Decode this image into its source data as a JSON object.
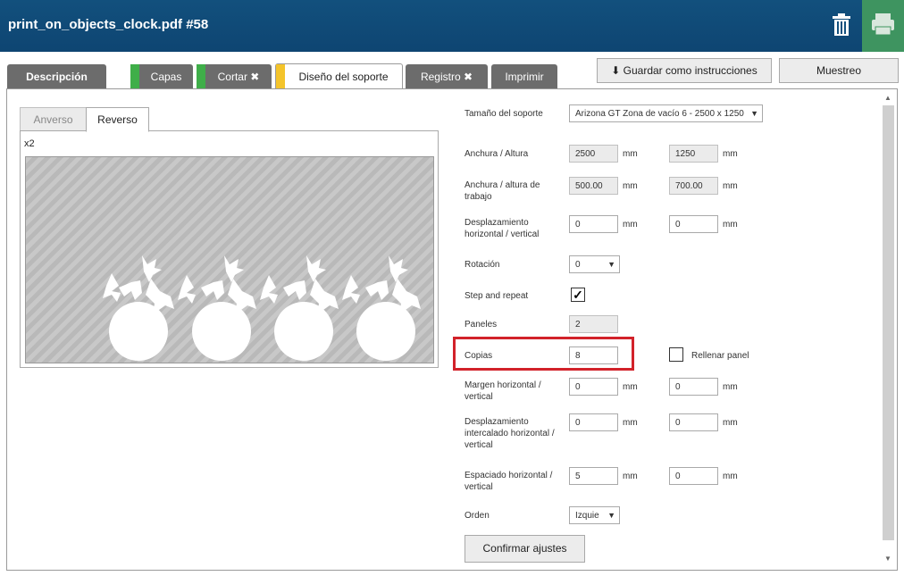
{
  "header": {
    "title": "print_on_objects_clock.pdf #58"
  },
  "tabs": {
    "descripcion": "Descripción",
    "capas": "Capas",
    "cortar": "Cortar ✖",
    "diseno": "Diseño del soporte",
    "registro": "Registro ✖",
    "imprimir": "Imprimir"
  },
  "tab_colors": {
    "capas": "#3fae49",
    "cortar": "#3fae49",
    "diseno": "#f4c42b"
  },
  "toolbar": {
    "save_label": "⬇ Guardar como instrucciones",
    "sample_label": "Muestreo"
  },
  "preview": {
    "tab_front": "Anverso",
    "tab_back": "Reverso",
    "multiplier": "x2"
  },
  "form": {
    "media_size_label": "Tamaño del soporte",
    "media_size_value": "Arizona GT Zona de vacío 6 - 2500 x 1250",
    "width_height_label": "Anchura / Altura",
    "width": "2500",
    "height": "1250",
    "work_wh_label": "Anchura / altura de trabajo",
    "work_width": "500.00",
    "work_height": "700.00",
    "offset_label": "Desplazamiento horizontal / vertical",
    "offset_h": "0",
    "offset_v": "0",
    "rotation_label": "Rotación",
    "rotation_value": "0",
    "step_repeat_label": "Step and repeat",
    "step_repeat_checked": "✓",
    "panels_label": "Paneles",
    "panels_value": "2",
    "copies_label": "Copias",
    "copies_value": "8",
    "fill_panel_label": "Rellenar panel",
    "margin_label": "Margen horizontal / vertical",
    "margin_h": "0",
    "margin_v": "0",
    "stagger_label": "Desplazamiento intercalado horizontal / vertical",
    "stagger_h": "0",
    "stagger_v": "0",
    "spacing_label": "Espaciado horizontal / vertical",
    "spacing_h": "5",
    "spacing_v": "0",
    "order_label": "Orden",
    "order_value": "Izquie",
    "unit": "mm",
    "confirm_label": "Confirmar ajustes"
  },
  "icons": {
    "trash": "trash-icon",
    "print": "printer-icon",
    "download": "download-icon"
  }
}
